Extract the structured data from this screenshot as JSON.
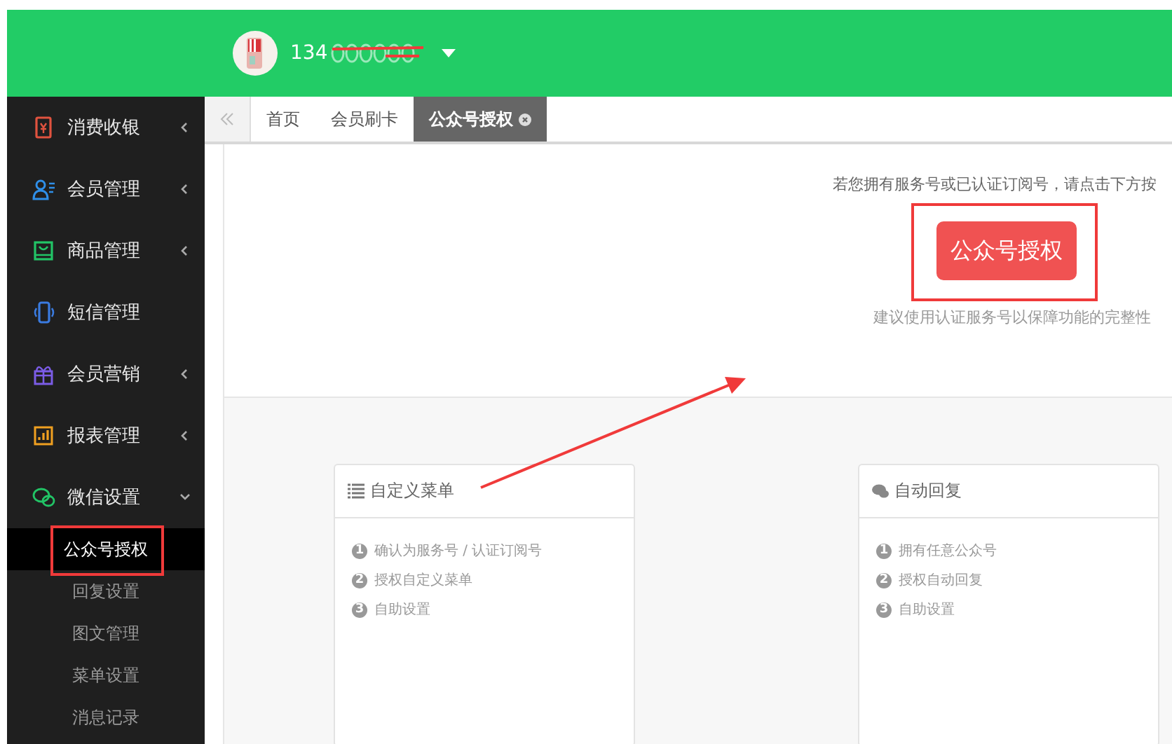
{
  "header": {
    "user_name": "134"
  },
  "sidebar": {
    "items": [
      {
        "label": "消费收银",
        "color": "#e0533f",
        "expanded": false
      },
      {
        "label": "会员管理",
        "color": "#2f8fe8",
        "expanded": false
      },
      {
        "label": "商品管理",
        "color": "#22c466",
        "expanded": false
      },
      {
        "label": "短信管理",
        "color": "#3a7be0"
      },
      {
        "label": "会员营销",
        "color": "#7b5ce6",
        "expanded": false
      },
      {
        "label": "报表管理",
        "color": "#f0a020",
        "expanded": false
      },
      {
        "label": "微信设置",
        "color": "#22c466",
        "expanded": true,
        "children": [
          {
            "label": "公众号授权",
            "selected": true
          },
          {
            "label": "回复设置",
            "selected": false
          },
          {
            "label": "图文管理",
            "selected": false
          },
          {
            "label": "菜单设置",
            "selected": false
          },
          {
            "label": "消息记录",
            "selected": false
          }
        ]
      }
    ]
  },
  "tabs": [
    {
      "label": "首页",
      "selected": false,
      "closable": false
    },
    {
      "label": "会员刷卡",
      "selected": false,
      "closable": false
    },
    {
      "label": "公众号授权",
      "selected": true,
      "closable": true
    }
  ],
  "auth_panel": {
    "prompt": "若您拥有服务号或已认证订阅号，请点击下方按",
    "button": "公众号授权",
    "hint": "建议使用认证服务号以保障功能的完整性"
  },
  "cards": [
    {
      "title": "自定义菜单",
      "steps": [
        {
          "number": "1",
          "text": "确认为服务号 / 认证订阅号"
        },
        {
          "number": "2",
          "text": "授权自定义菜单"
        },
        {
          "number": "3",
          "text": "自助设置"
        }
      ]
    },
    {
      "title": "自动回复",
      "steps": [
        {
          "number": "1",
          "text": "拥有任意公众号"
        },
        {
          "number": "2",
          "text": "授权自动回复"
        },
        {
          "number": "3",
          "text": "自助设置"
        }
      ]
    }
  ]
}
